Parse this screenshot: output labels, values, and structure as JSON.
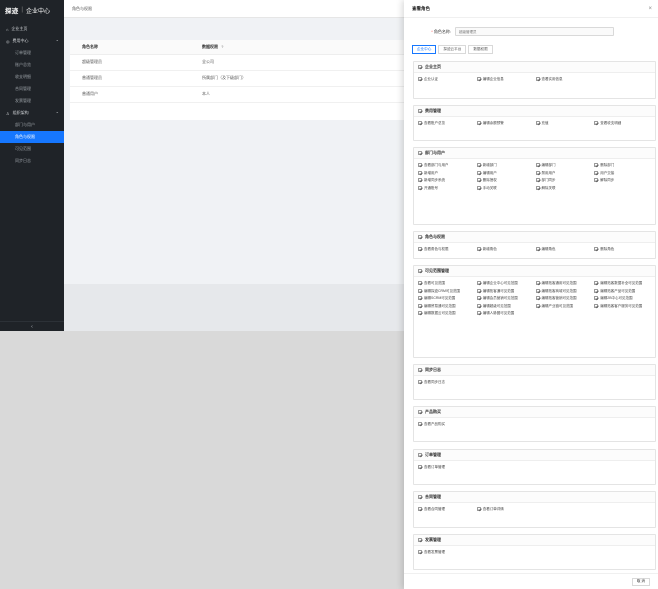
{
  "brand": {
    "logo": "探迹",
    "separator": "|",
    "title": "企业中心"
  },
  "sidebar": {
    "items": [
      {
        "label": "企业主页",
        "type": "group",
        "icon": "home-icon"
      },
      {
        "label": "费用中心",
        "type": "group",
        "icon": "wallet-icon",
        "caret": "⌃"
      },
      {
        "label": "订单管理",
        "type": "sub"
      },
      {
        "label": "账户总览",
        "type": "sub"
      },
      {
        "label": "收支明细",
        "type": "sub"
      },
      {
        "label": "合同管理",
        "type": "sub"
      },
      {
        "label": "发票管理",
        "type": "sub"
      },
      {
        "label": "组织架构",
        "type": "group",
        "icon": "org-icon",
        "caret": "⌃"
      },
      {
        "label": "部门与用户",
        "type": "sub"
      },
      {
        "label": "角色与权限",
        "type": "sub",
        "active": true
      },
      {
        "label": "可见范围",
        "type": "sub"
      },
      {
        "label": "同步日志",
        "type": "sub"
      }
    ],
    "collapse_icon": "‹"
  },
  "main": {
    "breadcrumb": "角色与权限",
    "table": {
      "headers": [
        "角色名称",
        "数据权限"
      ],
      "header_help": "?",
      "rows": [
        [
          "超级管理员",
          "全公司"
        ],
        [
          "普通管理员",
          "所属部门（及下级部门）"
        ],
        [
          "普通用户",
          "本人"
        ]
      ]
    }
  },
  "drawer": {
    "title": "查看角色",
    "close": "×",
    "role_label": "角色名称:",
    "required_mark": "*",
    "role_placeholder": "超级管理员",
    "tabs": [
      "企业中心",
      "探迹云平台",
      "数据权限"
    ],
    "cancel": "取 消",
    "sections": [
      {
        "title": "企业主页",
        "items": [
          "企业认证",
          "编辑企业信息",
          "查看实用信息"
        ]
      },
      {
        "title": "费用管理",
        "items": [
          "查看账户总览",
          "编辑余额预警",
          "充值",
          "查看收支明细"
        ]
      },
      {
        "title": "部门与用户",
        "items": [
          "查看部门与用户",
          "新增部门",
          "编辑部门",
          "删除部门",
          "新增用户",
          "编辑用户",
          "禁用用户",
          "用户交接",
          "新增同步系统",
          "删除授权",
          "部门同步",
          "解除同步",
          "开通账号",
          "手动关联",
          "解除关联"
        ]
      },
      {
        "title": "角色与权限",
        "items": [
          "查看角色与权限",
          "新增角色",
          "编辑角色",
          "删除角色"
        ]
      },
      {
        "title": "可见范围管理",
        "items": [
          "查看可见范围",
          "编辑企业中心可见范围",
          "编辑拓客通用可见范围",
          "编辑拓客数据补全可见范围",
          "编辑探迹CRM可见范围",
          "编辑拓客通可见范围",
          "编辑拓客商城可见范围",
          "编辑拓客产品可见范围",
          "编辑SCRM可见范围",
          "编辑会员营销可见范围",
          "编辑拓客营销可见范围",
          "编辑2B中心可见范围",
          "编辑贸易通可见范围",
          "编辑超级可见范围",
          "编辑产业链可见范围",
          "编辑拓客客户服务可见范围",
          "编辑数据云可见范围",
          "编辑人脉圈可见范围"
        ]
      },
      {
        "title": "同步日志",
        "items": [
          "查看同步日志"
        ]
      },
      {
        "title": "产品购买",
        "items": [
          "查看产品购买"
        ]
      },
      {
        "title": "订单管理",
        "items": [
          "查看订单管理"
        ]
      },
      {
        "title": "合同管理",
        "items": [
          "查看合同管理",
          "查看订单详情"
        ]
      },
      {
        "title": "发票管理",
        "items": [
          "查看发票管理"
        ]
      }
    ]
  }
}
